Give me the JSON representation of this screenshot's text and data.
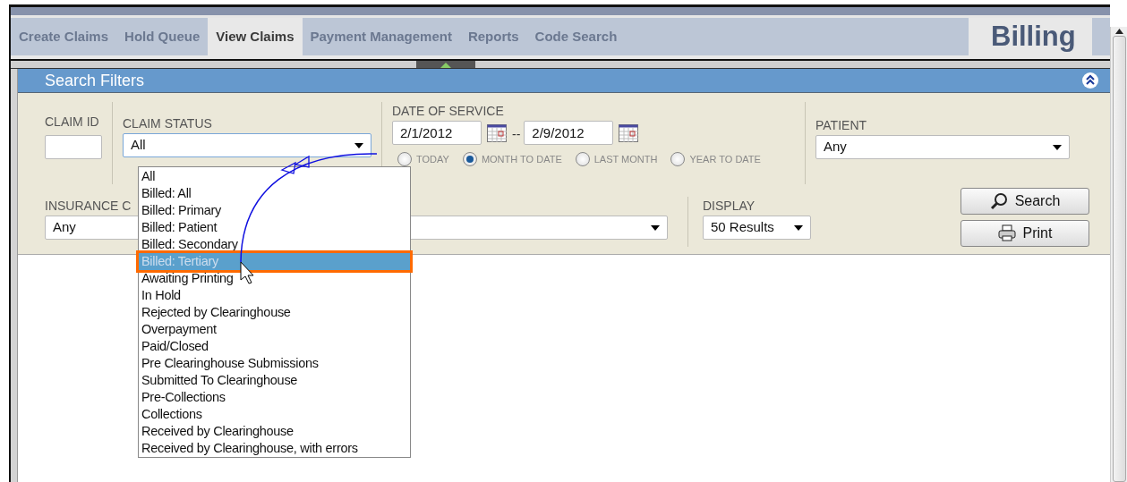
{
  "tabs": [
    {
      "label": "Create Claims",
      "selected": false
    },
    {
      "label": "Hold Queue",
      "selected": false
    },
    {
      "label": "View Claims",
      "selected": true
    },
    {
      "label": "Payment Management",
      "selected": false
    },
    {
      "label": "Reports",
      "selected": false
    },
    {
      "label": "Code Search",
      "selected": false
    }
  ],
  "app_title": "Billing",
  "panel": {
    "title": "Search Filters",
    "expanded": true
  },
  "filters": {
    "claim_id": {
      "label": "CLAIM ID"
    },
    "claim_status": {
      "label": "CLAIM STATUS",
      "value": "All",
      "open": true,
      "options": [
        {
          "label": "All",
          "highlighted": false
        },
        {
          "label": "Billed: All",
          "highlighted": false
        },
        {
          "label": "Billed: Primary",
          "highlighted": false
        },
        {
          "label": "Billed: Patient",
          "highlighted": false
        },
        {
          "label": "Billed: Secondary",
          "highlighted": false
        },
        {
          "label": "Billed: Tertiary",
          "highlighted": true
        },
        {
          "label": "Awaiting Printing",
          "highlighted": false
        },
        {
          "label": "In Hold",
          "highlighted": false
        },
        {
          "label": "Rejected by Clearinghouse",
          "highlighted": false
        },
        {
          "label": "Overpayment",
          "highlighted": false
        },
        {
          "label": "Paid/Closed",
          "highlighted": false
        },
        {
          "label": "Pre Clearinghouse Submissions",
          "highlighted": false
        },
        {
          "label": "Submitted To Clearinghouse",
          "highlighted": false
        },
        {
          "label": "Pre-Collections",
          "highlighted": false
        },
        {
          "label": "Collections",
          "highlighted": false
        },
        {
          "label": "Received by Clearinghouse",
          "highlighted": false
        },
        {
          "label": "Received by Clearinghouse, with errors",
          "highlighted": false
        }
      ]
    },
    "date_of_service": {
      "label": "DATE OF SERVICE",
      "from": "2/1/2012",
      "separator": "--",
      "to": "2/9/2012",
      "ranges": [
        {
          "label": "TODAY",
          "selected": false
        },
        {
          "label": "MONTH TO DATE",
          "selected": true
        },
        {
          "label": "LAST MONTH",
          "selected": false
        },
        {
          "label": "YEAR TO DATE",
          "selected": false
        }
      ]
    },
    "patient": {
      "label": "PATIENT",
      "value": "Any"
    },
    "insurance": {
      "label": "INSURANCE C",
      "value": "Any"
    },
    "display": {
      "label": "DISPLAY",
      "value": "50 Results"
    }
  },
  "buttons": [
    {
      "label": "Search",
      "kind": "search"
    },
    {
      "label": "Print",
      "kind": "print"
    }
  ]
}
